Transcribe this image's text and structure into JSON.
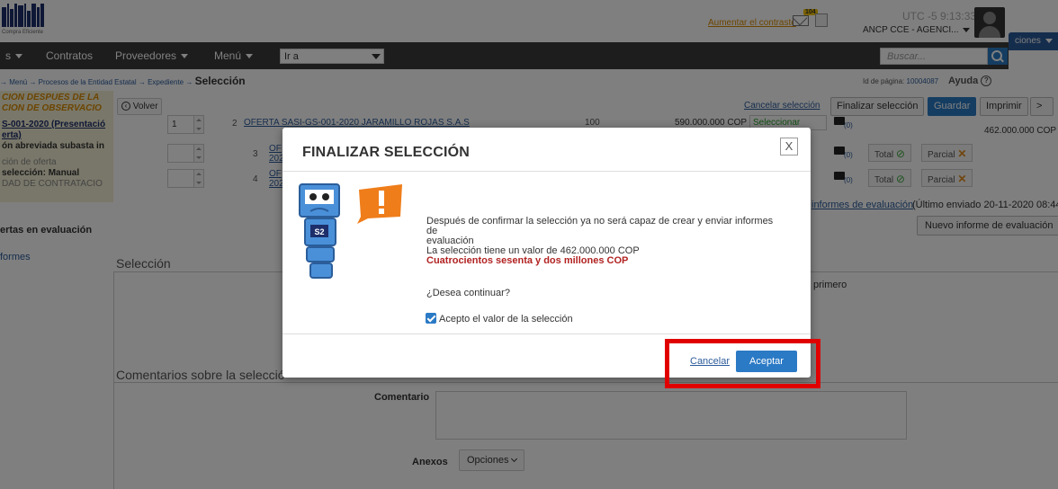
{
  "header": {
    "logo_text": "Compra Eficiente",
    "aumentar_link": "Aumentar el contraste",
    "mail_badge": "104",
    "utc": "UTC -5 9:13:33",
    "entity": "ANCP CCE - AGENCI...",
    "opciones_label": "ciones"
  },
  "navbar": {
    "items": [
      "s",
      "Contratos",
      "Proveedores",
      "Menú"
    ],
    "ira_value": "Ir a",
    "buscar_placeholder": "Buscar..."
  },
  "breadcrumb": {
    "prefix": "→ Menú → Procesos de la Entidad Estatal → Expediente →",
    "current": "Selección"
  },
  "page_id": {
    "label": "Id de página:",
    "value": "10004087",
    "ayuda": "Ayuda"
  },
  "sidebar": {
    "lines": [
      "CIÓN DESPUÉS DE LA",
      "CIÓN DE OBSERVACIO",
      "S-001-2020 (Presentació",
      "erta)",
      "ón abreviada subasta in",
      "ción de oferta",
      "selección: Manual",
      "DAD DE CONTRATACIÓ"
    ],
    "item_ofertas": "ertas en evaluación",
    "item_informes": "formes"
  },
  "toolbar": {
    "volver": "Volver",
    "cancelar_seleccion": "Cancelar selección",
    "finalizar": "Finalizar selección",
    "guardar": "Guardar",
    "imprimir": "Imprimir",
    "next": ">"
  },
  "rows": [
    {
      "rank": "1",
      "num": "2",
      "offer": "OFERTA SASI-GS-001-2020 JARAMILLO ROJAS S.A.S",
      "score": "100",
      "amount": "590.000.000 COP",
      "select": "Seleccionar",
      "comments": "(0)"
    },
    {
      "rank": "",
      "num": "3",
      "offer": "OF 202",
      "score": "",
      "amount": "",
      "select": "",
      "comments": "(0)"
    },
    {
      "rank": "",
      "num": "4",
      "offer": "OF 202",
      "score": "",
      "amount": "",
      "select": "",
      "comments": "(0)"
    }
  ],
  "pills": {
    "total": "Total",
    "parcial": "Parcial"
  },
  "total_amount": "462.000.000 COP",
  "informes": {
    "link": "informes de evaluación",
    "ultimo": "(Último enviado 20-11-2020 08:44)",
    "nuevo_btn": "Nuevo informe de evaluación",
    "primero": "primero"
  },
  "sections": {
    "seleccion": "Selección",
    "comentarios": "Comentarios sobre la selecció",
    "comentario_label": "Comentario",
    "anexos_label": "Anexos",
    "opciones": "Opciones"
  },
  "modal": {
    "title": "FINALIZAR SELECCIÓN",
    "close": "X",
    "line1": "Después de confirmar la selección ya no será capaz de crear y enviar informes de",
    "line2": "evaluación",
    "line3": "La selección tiene un valor de 462.000.000 COP",
    "line4_red": "Cuatrocientos sesenta y dos millones COP",
    "question": "¿Desea continuar?",
    "accept_checkbox": "Acepto el valor de la selección",
    "accept_checked": true,
    "cancel": "Cancelar",
    "accept": "Aceptar",
    "robot_label": "S2"
  },
  "colors": {
    "nav_bg": "#3b3b3b",
    "primary": "#2b7ac5",
    "highlight": "#e00000",
    "red_text": "#b22222",
    "sidebar_bg": "#f3eed3"
  }
}
